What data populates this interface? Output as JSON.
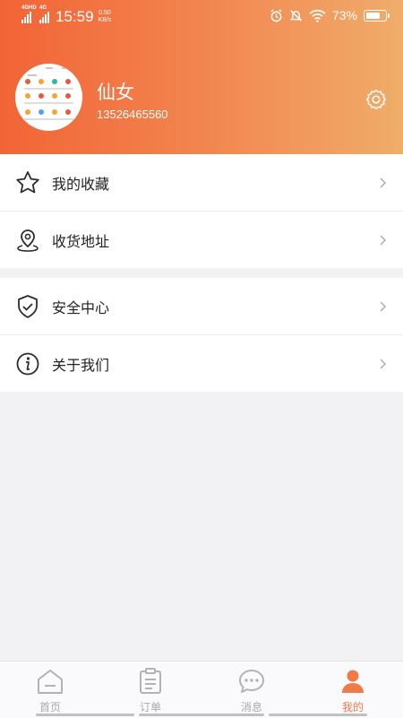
{
  "status_bar": {
    "network_1": "4G",
    "network_1_suffix": "HD",
    "network_2": "4G",
    "time": "15:59",
    "speed_value": "0.50",
    "speed_unit": "KB/s",
    "battery_percent": "73%",
    "battery_level": 0.73,
    "icons": [
      "alarm-icon",
      "mute-icon",
      "wifi-icon",
      "battery-icon"
    ]
  },
  "profile": {
    "name": "仙女",
    "phone": "13526465560",
    "header_colors": [
      "#f26436",
      "#f0ad6a"
    ]
  },
  "menu_groups": [
    [
      {
        "label": "我的收藏",
        "icon": "star-icon"
      },
      {
        "label": "收货地址",
        "icon": "location-pin-icon"
      }
    ],
    [
      {
        "label": "安全中心",
        "icon": "shield-check-icon"
      },
      {
        "label": "关于我们",
        "icon": "info-icon"
      }
    ]
  ],
  "tabs": [
    {
      "label": "首页",
      "icon": "home-icon",
      "active": false
    },
    {
      "label": "订单",
      "icon": "order-list-icon",
      "active": false
    },
    {
      "label": "消息",
      "icon": "message-icon",
      "active": false
    },
    {
      "label": "我的",
      "icon": "user-icon",
      "active": true
    }
  ],
  "colors": {
    "accent": "#f07a48",
    "inactive": "#aaaaaa",
    "background": "#f2f1f4"
  }
}
